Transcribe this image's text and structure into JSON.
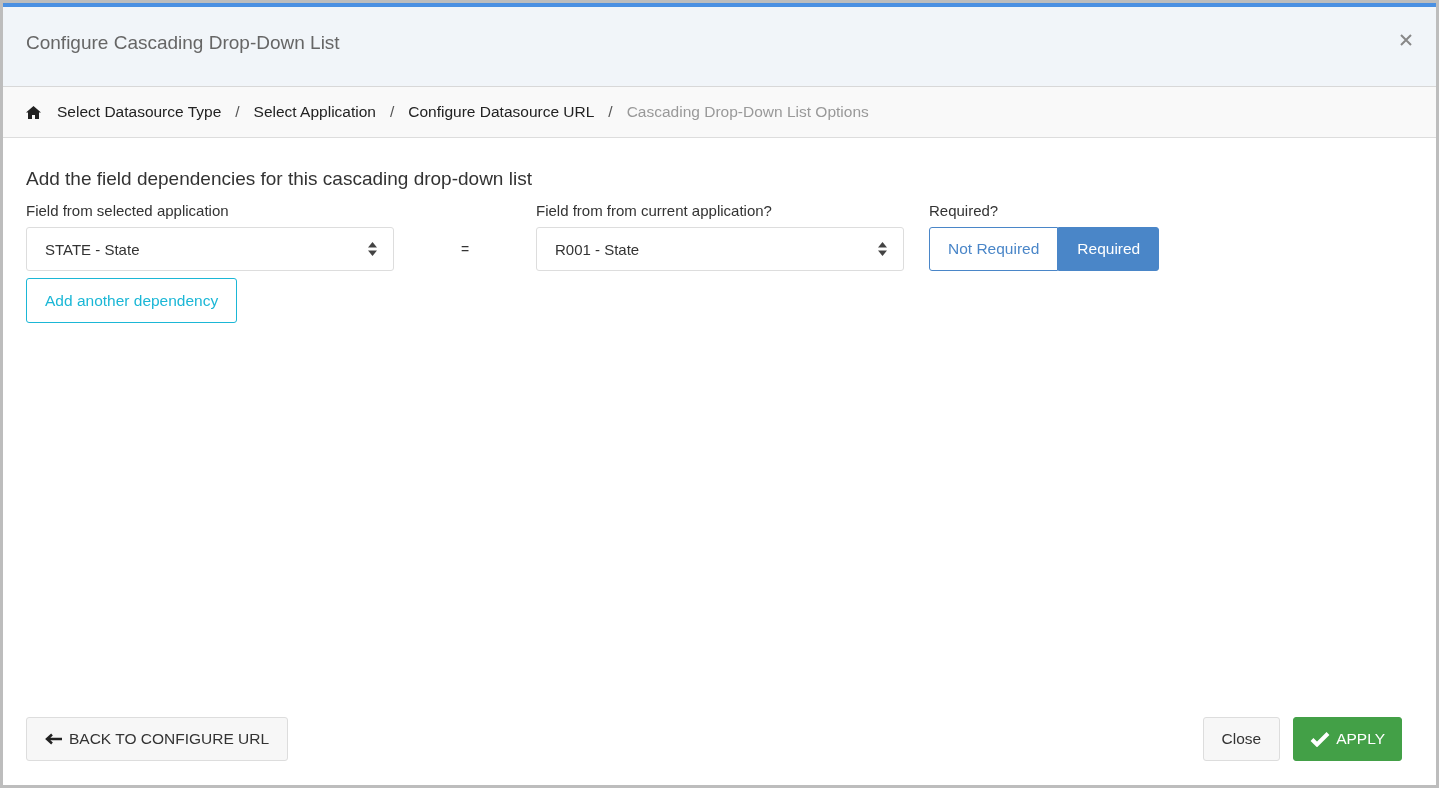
{
  "window": {
    "title": "Configure Cascading Drop-Down List"
  },
  "breadcrumb": [
    {
      "label": "Select Datasource Type",
      "selected": false
    },
    {
      "label": "Select Application",
      "selected": false
    },
    {
      "label": "Configure Datasource URL",
      "selected": false
    },
    {
      "label": "Cascading Drop-Down List Options",
      "selected": true
    }
  ],
  "breadcrumb_separator": "/",
  "heading": "Add the field dependencies for this cascading drop-down list",
  "dependency": {
    "source_label": "Field from selected application",
    "source_value": "STATE - State",
    "equals": "=",
    "target_label": "Field from from current application?",
    "target_value": "R001 - State",
    "required_label": "Required?",
    "required_options": [
      {
        "label": "Not Required",
        "selected": false
      },
      {
        "label": "Required",
        "selected": true
      }
    ]
  },
  "add_button": "Add another dependency",
  "footer": {
    "back_button": "BACK TO CONFIGURE URL",
    "close_button": "Close",
    "apply_button": "APPLY"
  }
}
